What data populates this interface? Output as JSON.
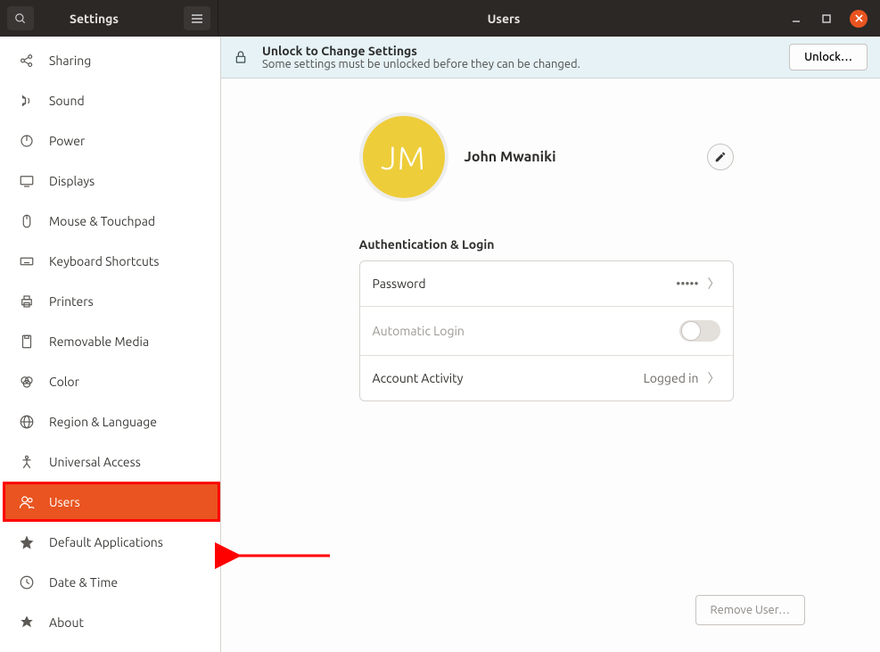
{
  "window": {
    "app_title": "Settings",
    "page_title": "Users"
  },
  "sidebar": {
    "items": [
      {
        "label": "Sharing",
        "icon": "sharing"
      },
      {
        "label": "Sound",
        "icon": "sound"
      },
      {
        "label": "Power",
        "icon": "power"
      },
      {
        "label": "Displays",
        "icon": "displays"
      },
      {
        "label": "Mouse & Touchpad",
        "icon": "mouse"
      },
      {
        "label": "Keyboard Shortcuts",
        "icon": "keyboard"
      },
      {
        "label": "Printers",
        "icon": "printers"
      },
      {
        "label": "Removable Media",
        "icon": "media"
      },
      {
        "label": "Color",
        "icon": "color"
      },
      {
        "label": "Region & Language",
        "icon": "region"
      },
      {
        "label": "Universal Access",
        "icon": "access"
      },
      {
        "label": "Users",
        "icon": "users",
        "active": true
      },
      {
        "label": "Default Applications",
        "icon": "star"
      },
      {
        "label": "Date & Time",
        "icon": "clock"
      },
      {
        "label": "About",
        "icon": "about"
      }
    ]
  },
  "infobar": {
    "title": "Unlock to Change Settings",
    "subtitle": "Some settings must be unlocked before they can be changed.",
    "button": "Unlock…"
  },
  "user": {
    "initials": "JM",
    "name": "John Mwaniki",
    "avatar_color": "#eecd3b"
  },
  "auth_section": {
    "title": "Authentication & Login",
    "password": {
      "label": "Password",
      "value": "•••••"
    },
    "autologin": {
      "label": "Automatic Login",
      "enabled": false
    },
    "activity": {
      "label": "Account Activity",
      "value": "Logged in"
    }
  },
  "buttons": {
    "remove_user": "Remove User…"
  }
}
